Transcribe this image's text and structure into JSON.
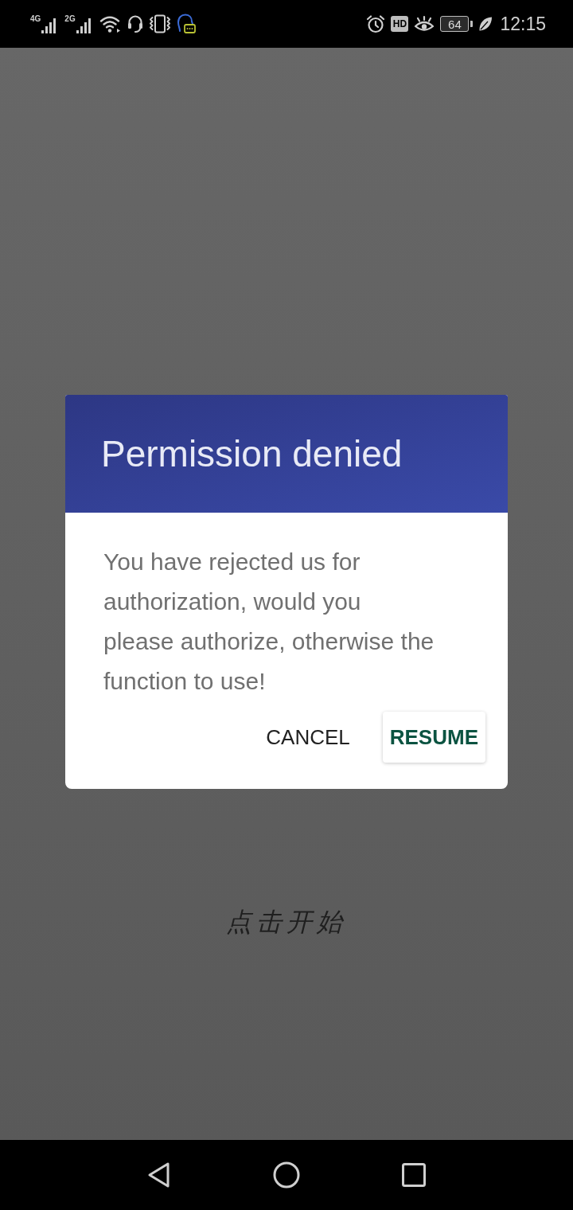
{
  "status_bar": {
    "left": [
      {
        "kind": "signal",
        "label": "4G"
      },
      {
        "kind": "signal",
        "label": "2G"
      },
      {
        "kind": "wifi"
      },
      {
        "kind": "headset"
      },
      {
        "kind": "vibrate"
      },
      {
        "kind": "assistant"
      }
    ],
    "right": [
      {
        "kind": "alarm"
      },
      {
        "kind": "badge",
        "label": "HD"
      },
      {
        "kind": "eye"
      },
      {
        "kind": "battery",
        "label": "64"
      },
      {
        "kind": "leaf"
      }
    ],
    "time": "12:15"
  },
  "background": {
    "prompt": "点击开始"
  },
  "dialog": {
    "title": "Permission denied",
    "message": "You have rejected us for authorization, would you please authorize, otherwise the function to use!",
    "buttons": [
      {
        "label": "CANCEL",
        "kind": "default"
      },
      {
        "label": "RESUME",
        "kind": "primary"
      }
    ]
  },
  "nav_bar": {
    "buttons": [
      {
        "kind": "back"
      },
      {
        "kind": "home"
      },
      {
        "kind": "recents"
      }
    ]
  }
}
